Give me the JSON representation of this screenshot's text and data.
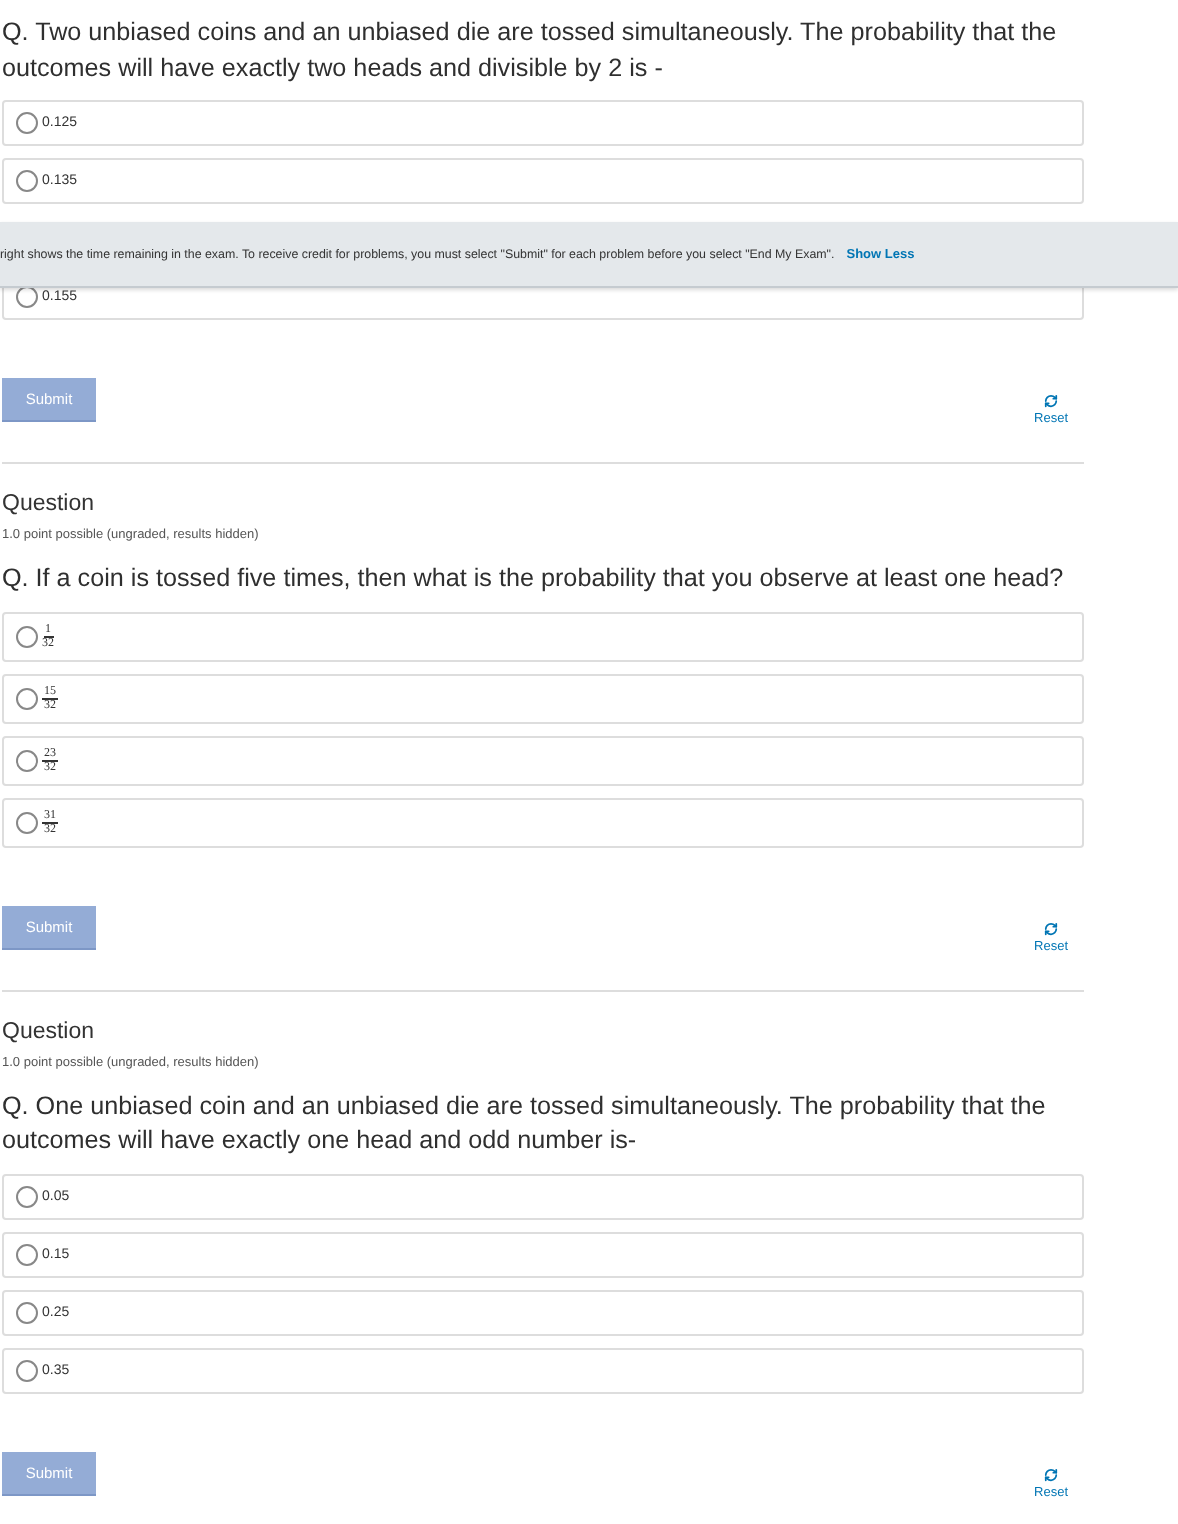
{
  "questions": [
    {
      "text": "Q. Two unbiased coins and an unbiased die are tossed simultaneously. The probability that the outcomes will have exactly two heads and divisible by 2 is -",
      "options": [
        {
          "kind": "text",
          "label": "0.125",
          "selected": false
        },
        {
          "kind": "text",
          "label": "0.135",
          "selected": false
        },
        {
          "kind": "text",
          "label": "0.155",
          "selected": false
        }
      ],
      "submit": "Submit",
      "reset": "Reset"
    },
    {
      "heading": "Question",
      "points": "1.0 point possible (ungraded, results hidden)",
      "text": "Q. If a coin is tossed five times, then what is the probability that you observe at least one head?",
      "options": [
        {
          "kind": "fraction",
          "numerator": "1",
          "denominator": "32",
          "selected": false
        },
        {
          "kind": "fraction",
          "numerator": "15",
          "denominator": "32",
          "selected": false
        },
        {
          "kind": "fraction",
          "numerator": "23",
          "denominator": "32",
          "selected": false
        },
        {
          "kind": "fraction",
          "numerator": "31",
          "denominator": "32",
          "selected": false
        }
      ],
      "submit": "Submit",
      "reset": "Reset"
    },
    {
      "heading": "Question",
      "points": "1.0 point possible (ungraded, results hidden)",
      "text": "Q. One unbiased coin and an unbiased die are tossed simultaneously. The probability that the outcomes will have exactly one head and odd number is-",
      "options": [
        {
          "kind": "text",
          "label": "0.05",
          "selected": false
        },
        {
          "kind": "text",
          "label": "0.15",
          "selected": false
        },
        {
          "kind": "text",
          "label": "0.25",
          "selected": false
        },
        {
          "kind": "text",
          "label": "0.35",
          "selected": false
        }
      ],
      "submit": "Submit",
      "reset": "Reset"
    }
  ],
  "banner": {
    "text": "right shows the time remaining in the exam. To receive credit for problems, you must select \"Submit\" for each problem before you select \"End My Exam\".",
    "link": "Show Less"
  }
}
